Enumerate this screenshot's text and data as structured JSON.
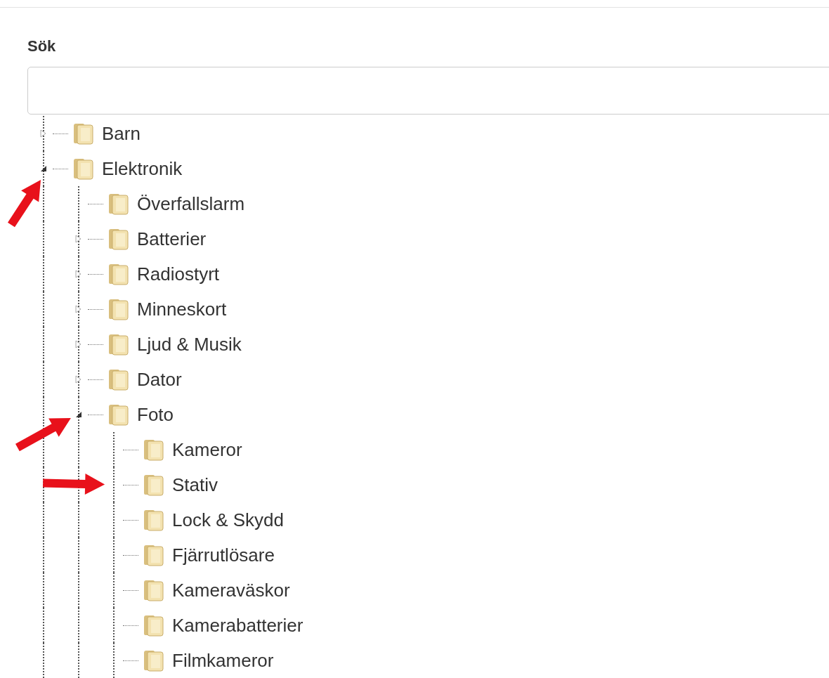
{
  "search": {
    "label": "Sök"
  },
  "tree": [
    {
      "label": "Barn",
      "kind": "branch",
      "expanded": false
    },
    {
      "label": "Elektronik",
      "kind": "branch",
      "expanded": true,
      "annotated": true,
      "children": [
        {
          "label": "Överfallslarm",
          "kind": "leaf"
        },
        {
          "label": "Batterier",
          "kind": "branch",
          "expanded": false
        },
        {
          "label": "Radiostyrt",
          "kind": "branch",
          "expanded": false
        },
        {
          "label": "Minneskort",
          "kind": "branch",
          "expanded": false
        },
        {
          "label": "Ljud & Musik",
          "kind": "branch",
          "expanded": false
        },
        {
          "label": "Dator",
          "kind": "branch",
          "expanded": false
        },
        {
          "label": "Foto",
          "kind": "branch",
          "expanded": true,
          "annotated": true,
          "children": [
            {
              "label": "Kameror",
              "kind": "leaf"
            },
            {
              "label": "Stativ",
              "kind": "leaf",
              "annotated": true
            },
            {
              "label": "Lock & Skydd",
              "kind": "leaf"
            },
            {
              "label": "Fjärrutlösare",
              "kind": "leaf"
            },
            {
              "label": "Kameraväskor",
              "kind": "leaf"
            },
            {
              "label": "Kamerabatterier",
              "kind": "leaf"
            },
            {
              "label": "Filmkameror",
              "kind": "leaf"
            }
          ]
        }
      ]
    }
  ]
}
